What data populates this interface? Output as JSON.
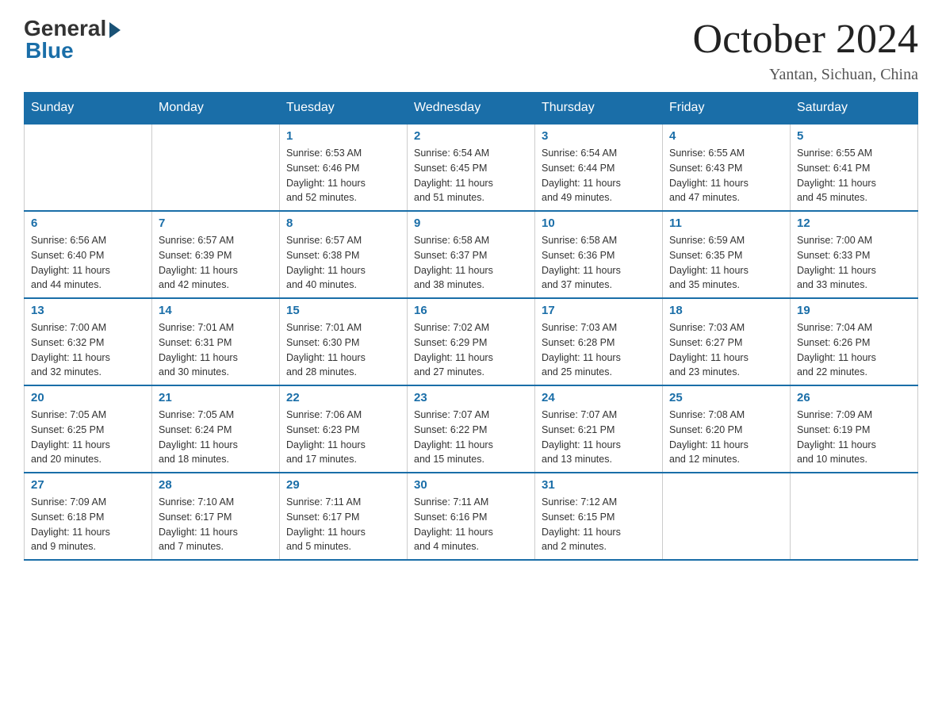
{
  "logo": {
    "general": "General",
    "blue": "Blue"
  },
  "title": {
    "month_year": "October 2024",
    "location": "Yantan, Sichuan, China"
  },
  "header_days": [
    "Sunday",
    "Monday",
    "Tuesday",
    "Wednesday",
    "Thursday",
    "Friday",
    "Saturday"
  ],
  "weeks": [
    [
      {
        "day": "",
        "info": ""
      },
      {
        "day": "",
        "info": ""
      },
      {
        "day": "1",
        "info": "Sunrise: 6:53 AM\nSunset: 6:46 PM\nDaylight: 11 hours\nand 52 minutes."
      },
      {
        "day": "2",
        "info": "Sunrise: 6:54 AM\nSunset: 6:45 PM\nDaylight: 11 hours\nand 51 minutes."
      },
      {
        "day": "3",
        "info": "Sunrise: 6:54 AM\nSunset: 6:44 PM\nDaylight: 11 hours\nand 49 minutes."
      },
      {
        "day": "4",
        "info": "Sunrise: 6:55 AM\nSunset: 6:43 PM\nDaylight: 11 hours\nand 47 minutes."
      },
      {
        "day": "5",
        "info": "Sunrise: 6:55 AM\nSunset: 6:41 PM\nDaylight: 11 hours\nand 45 minutes."
      }
    ],
    [
      {
        "day": "6",
        "info": "Sunrise: 6:56 AM\nSunset: 6:40 PM\nDaylight: 11 hours\nand 44 minutes."
      },
      {
        "day": "7",
        "info": "Sunrise: 6:57 AM\nSunset: 6:39 PM\nDaylight: 11 hours\nand 42 minutes."
      },
      {
        "day": "8",
        "info": "Sunrise: 6:57 AM\nSunset: 6:38 PM\nDaylight: 11 hours\nand 40 minutes."
      },
      {
        "day": "9",
        "info": "Sunrise: 6:58 AM\nSunset: 6:37 PM\nDaylight: 11 hours\nand 38 minutes."
      },
      {
        "day": "10",
        "info": "Sunrise: 6:58 AM\nSunset: 6:36 PM\nDaylight: 11 hours\nand 37 minutes."
      },
      {
        "day": "11",
        "info": "Sunrise: 6:59 AM\nSunset: 6:35 PM\nDaylight: 11 hours\nand 35 minutes."
      },
      {
        "day": "12",
        "info": "Sunrise: 7:00 AM\nSunset: 6:33 PM\nDaylight: 11 hours\nand 33 minutes."
      }
    ],
    [
      {
        "day": "13",
        "info": "Sunrise: 7:00 AM\nSunset: 6:32 PM\nDaylight: 11 hours\nand 32 minutes."
      },
      {
        "day": "14",
        "info": "Sunrise: 7:01 AM\nSunset: 6:31 PM\nDaylight: 11 hours\nand 30 minutes."
      },
      {
        "day": "15",
        "info": "Sunrise: 7:01 AM\nSunset: 6:30 PM\nDaylight: 11 hours\nand 28 minutes."
      },
      {
        "day": "16",
        "info": "Sunrise: 7:02 AM\nSunset: 6:29 PM\nDaylight: 11 hours\nand 27 minutes."
      },
      {
        "day": "17",
        "info": "Sunrise: 7:03 AM\nSunset: 6:28 PM\nDaylight: 11 hours\nand 25 minutes."
      },
      {
        "day": "18",
        "info": "Sunrise: 7:03 AM\nSunset: 6:27 PM\nDaylight: 11 hours\nand 23 minutes."
      },
      {
        "day": "19",
        "info": "Sunrise: 7:04 AM\nSunset: 6:26 PM\nDaylight: 11 hours\nand 22 minutes."
      }
    ],
    [
      {
        "day": "20",
        "info": "Sunrise: 7:05 AM\nSunset: 6:25 PM\nDaylight: 11 hours\nand 20 minutes."
      },
      {
        "day": "21",
        "info": "Sunrise: 7:05 AM\nSunset: 6:24 PM\nDaylight: 11 hours\nand 18 minutes."
      },
      {
        "day": "22",
        "info": "Sunrise: 7:06 AM\nSunset: 6:23 PM\nDaylight: 11 hours\nand 17 minutes."
      },
      {
        "day": "23",
        "info": "Sunrise: 7:07 AM\nSunset: 6:22 PM\nDaylight: 11 hours\nand 15 minutes."
      },
      {
        "day": "24",
        "info": "Sunrise: 7:07 AM\nSunset: 6:21 PM\nDaylight: 11 hours\nand 13 minutes."
      },
      {
        "day": "25",
        "info": "Sunrise: 7:08 AM\nSunset: 6:20 PM\nDaylight: 11 hours\nand 12 minutes."
      },
      {
        "day": "26",
        "info": "Sunrise: 7:09 AM\nSunset: 6:19 PM\nDaylight: 11 hours\nand 10 minutes."
      }
    ],
    [
      {
        "day": "27",
        "info": "Sunrise: 7:09 AM\nSunset: 6:18 PM\nDaylight: 11 hours\nand 9 minutes."
      },
      {
        "day": "28",
        "info": "Sunrise: 7:10 AM\nSunset: 6:17 PM\nDaylight: 11 hours\nand 7 minutes."
      },
      {
        "day": "29",
        "info": "Sunrise: 7:11 AM\nSunset: 6:17 PM\nDaylight: 11 hours\nand 5 minutes."
      },
      {
        "day": "30",
        "info": "Sunrise: 7:11 AM\nSunset: 6:16 PM\nDaylight: 11 hours\nand 4 minutes."
      },
      {
        "day": "31",
        "info": "Sunrise: 7:12 AM\nSunset: 6:15 PM\nDaylight: 11 hours\nand 2 minutes."
      },
      {
        "day": "",
        "info": ""
      },
      {
        "day": "",
        "info": ""
      }
    ]
  ]
}
